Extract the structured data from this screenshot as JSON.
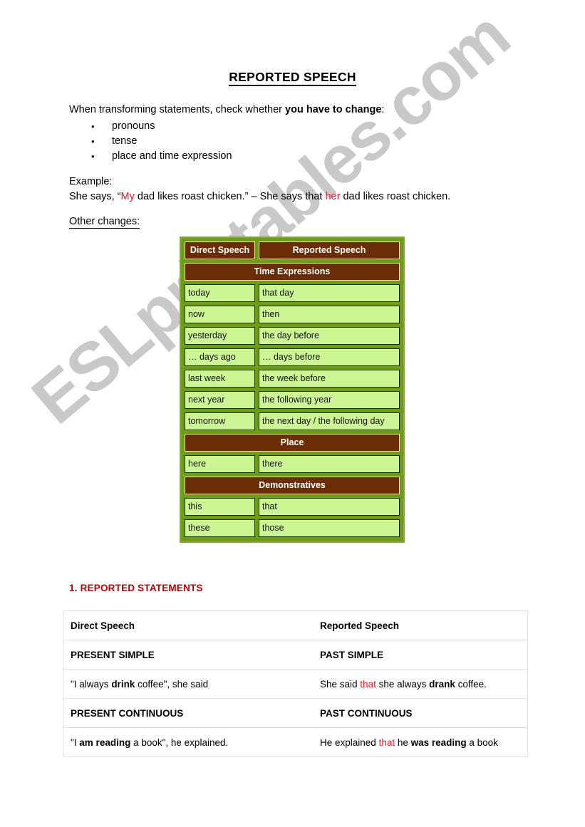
{
  "watermark": {
    "text": "ESLprintables.com",
    "color": "#c9c9c9"
  },
  "document": {
    "title": "REPORTED SPEECH",
    "intro_prefix": "When transforming statements, check whether ",
    "intro_bold": "you have to change",
    "intro_suffix": ":",
    "bullets": [
      "pronouns",
      "tense",
      "place and time expression"
    ],
    "example_label": "Example:",
    "example": {
      "part1": "She says, “",
      "red1": "My",
      "part2": " dad likes roast chicken.” – She says that ",
      "red2": "her",
      "part3": " dad likes roast chicken."
    },
    "other_changes_label": "Other changes:"
  },
  "changes_table": {
    "colors": {
      "frame_green": "#6f9b18",
      "header_brown": "#6b2d06",
      "cell_green": "#ccf694",
      "header_text": "#ffffff"
    },
    "header": {
      "direct": "Direct Speech",
      "reported": "Reported Speech"
    },
    "sections": [
      {
        "band": "Time Expressions",
        "rows": [
          {
            "direct": "today",
            "reported": "that day"
          },
          {
            "direct": "now",
            "reported": "then"
          },
          {
            "direct": "yesterday",
            "reported": "the day before"
          },
          {
            "direct": "… days ago",
            "reported": "… days before"
          },
          {
            "direct": "last week",
            "reported": "the week before"
          },
          {
            "direct": "next year",
            "reported": "the following year"
          },
          {
            "direct": "tomorrow",
            "reported": "the next day / the following day"
          }
        ]
      },
      {
        "band": "Place",
        "rows": [
          {
            "direct": "here",
            "reported": "there"
          }
        ]
      },
      {
        "band": "Demonstratives",
        "rows": [
          {
            "direct": "this",
            "reported": "that"
          },
          {
            "direct": "these",
            "reported": "those"
          }
        ]
      }
    ]
  },
  "statements": {
    "heading": "1. REPORTED STATEMENTS",
    "accent_color": "#c00000",
    "columns": {
      "direct": "Direct Speech",
      "reported": "Reported Speech"
    },
    "rows": [
      {
        "type": "label",
        "direct": "PRESENT SIMPLE",
        "reported": "PAST SIMPLE"
      },
      {
        "type": "example",
        "direct": {
          "p1": "\"I always ",
          "b1": "drink",
          "p2": " coffee\", she said"
        },
        "reported": {
          "p1": "She said ",
          "r1": "that",
          "p2": " she always ",
          "b1": "drank",
          "p3": " coffee."
        }
      },
      {
        "type": "label",
        "direct": "PRESENT CONTINUOUS",
        "reported": "PAST CONTINUOUS"
      },
      {
        "type": "example",
        "direct": {
          "p1": "\"I ",
          "b1": "am reading",
          "p2": " a book\", he explained."
        },
        "reported": {
          "p1": "He explained ",
          "r1": "that",
          "p2": " he ",
          "b1": "was reading",
          "p3": " a book"
        }
      }
    ]
  }
}
